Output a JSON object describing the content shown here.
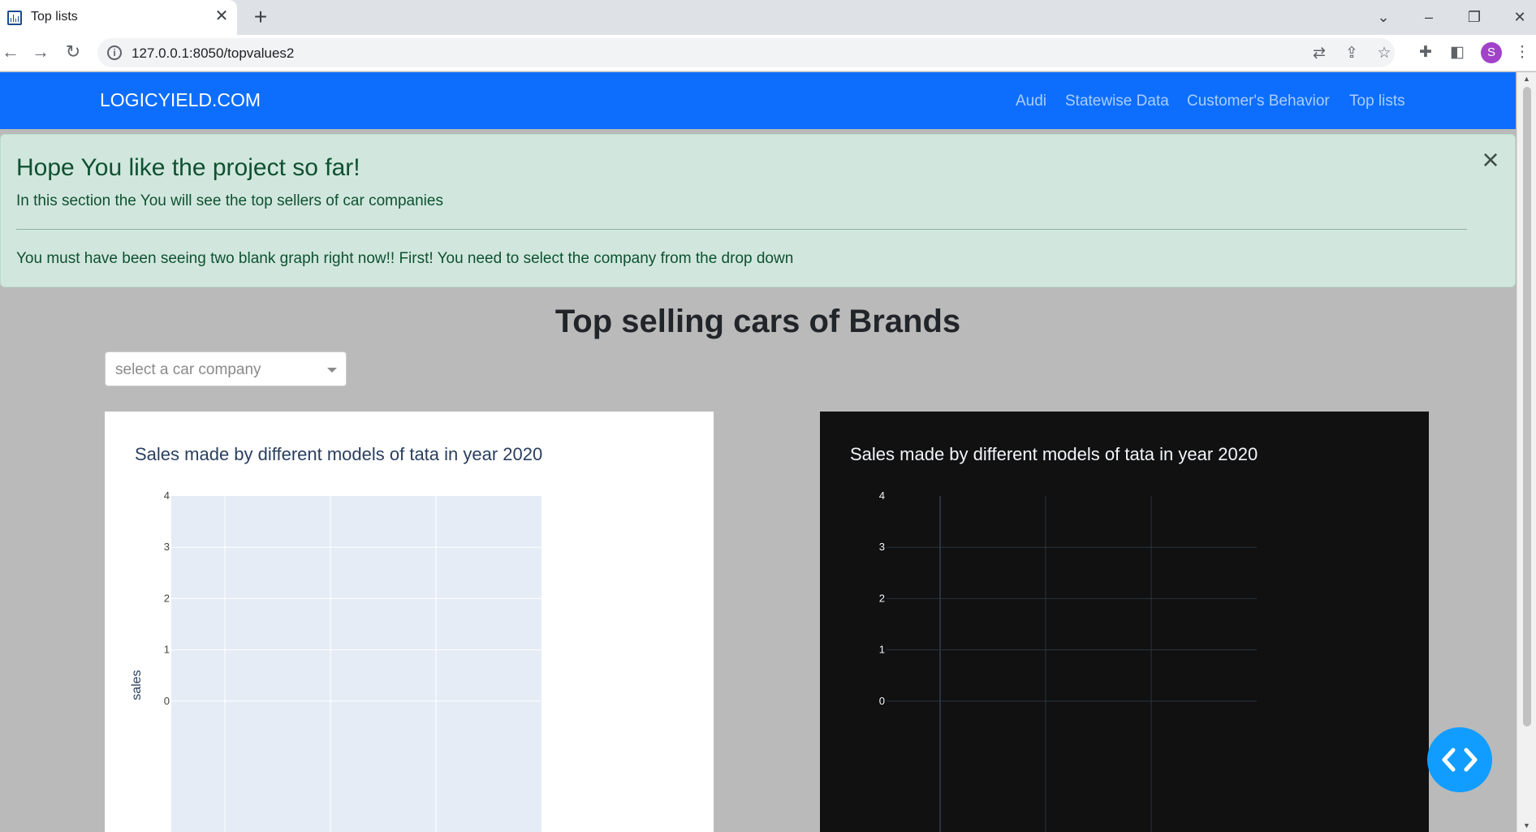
{
  "browser": {
    "tab_title": "Top lists",
    "url": "127.0.0.1:8050/topvalues2",
    "profile_initial": "S",
    "icons": [
      "chart-favicon-icon",
      "close-icon",
      "plus-icon",
      "chevron-down-icon",
      "minimize-icon",
      "restore-icon",
      "window-close-icon",
      "back-icon",
      "forward-icon",
      "reload-icon",
      "info-icon",
      "translate-icon",
      "share-icon",
      "star-icon",
      "extensions-icon",
      "side-panel-icon",
      "menu-icon"
    ]
  },
  "navbar": {
    "brand": "LOGICYIELD.COM",
    "links": [
      "Audi",
      "Statewise Data",
      "Customer's Behavior",
      "Top lists"
    ]
  },
  "alert": {
    "heading": "Hope You like the project so far!",
    "text": "In this section the You will see the top sellers of car companies",
    "note": "You must have been seeing two blank graph right now!! First! You need to select the company from the drop down",
    "close_symbol": "×"
  },
  "page": {
    "title": "Top selling cars of Brands"
  },
  "dropdown": {
    "placeholder": "select a car company"
  },
  "colors": {
    "navbar": "#0d6efd",
    "alert_bg": "#d1e7dd",
    "page_bg": "#bababa",
    "plot_light_bg": "#e5ecf6",
    "plot_dark_bg": "#111111",
    "fab": "#119dff"
  },
  "chart_data": [
    {
      "type": "bar",
      "theme": "light",
      "title": "Sales made by different models of tata in year 2020",
      "xlabel": "",
      "ylabel": "sales",
      "categories": [],
      "values": [],
      "ylim": [
        -1,
        4
      ],
      "yticks": [
        0,
        1,
        2,
        3,
        4
      ],
      "grid": true
    },
    {
      "type": "bar",
      "theme": "dark",
      "title": "Sales made by different models of tata in year 2020",
      "xlabel": "",
      "ylabel": "",
      "categories": [],
      "values": [],
      "ylim": [
        -1,
        4
      ],
      "yticks": [
        0,
        1,
        2,
        3,
        4
      ],
      "grid": true
    }
  ]
}
